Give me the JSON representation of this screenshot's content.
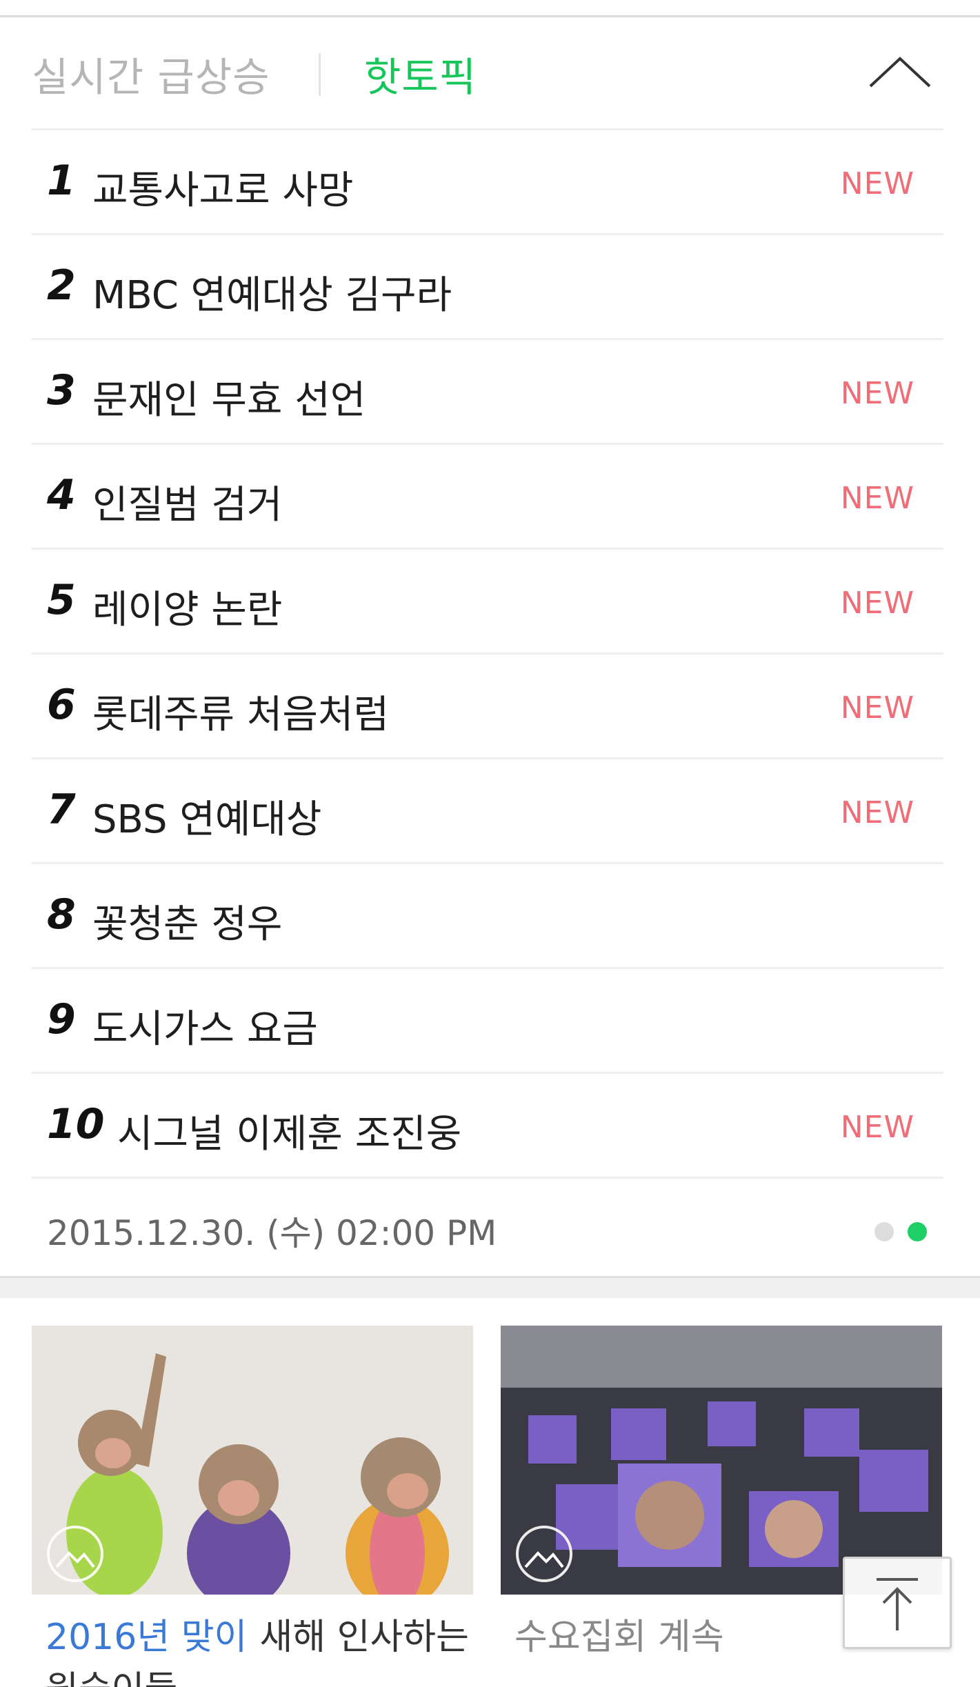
{
  "tabs": {
    "realtime_label": "실시간 급상승",
    "hot_label": "핫토픽",
    "active_color": "#17c65b"
  },
  "ranking": [
    {
      "rank": "1",
      "keyword": "교통사고로 사망",
      "badge": "NEW"
    },
    {
      "rank": "2",
      "keyword": "MBC 연예대상 김구라",
      "badge": ""
    },
    {
      "rank": "3",
      "keyword": "문재인 무효 선언",
      "badge": "NEW"
    },
    {
      "rank": "4",
      "keyword": "인질범 검거",
      "badge": "NEW"
    },
    {
      "rank": "5",
      "keyword": "레이양 논란",
      "badge": "NEW"
    },
    {
      "rank": "6",
      "keyword": "롯데주류 처음처럼",
      "badge": "NEW"
    },
    {
      "rank": "7",
      "keyword": "SBS 연예대상",
      "badge": "NEW"
    },
    {
      "rank": "8",
      "keyword": "꽃청춘 정우",
      "badge": ""
    },
    {
      "rank": "9",
      "keyword": "도시가스 요금",
      "badge": ""
    },
    {
      "rank": "10",
      "keyword": "시그널 이제훈 조진웅",
      "badge": "NEW"
    }
  ],
  "footer": {
    "timestamp": "2015.12.30. (수) 02:00 PM",
    "page_total": 2,
    "page_current": 2
  },
  "news": [
    {
      "highlight": "2016년 맞이",
      "title": "새해 인사하는 원숭이들",
      "icon": "photo-icon"
    },
    {
      "highlight": "",
      "title": "수요집회 계속",
      "icon": "photo-icon"
    }
  ],
  "colors": {
    "new_badge": "#f06d78",
    "highlight": "#3a7ad6",
    "dot_active": "#1ecf68"
  }
}
